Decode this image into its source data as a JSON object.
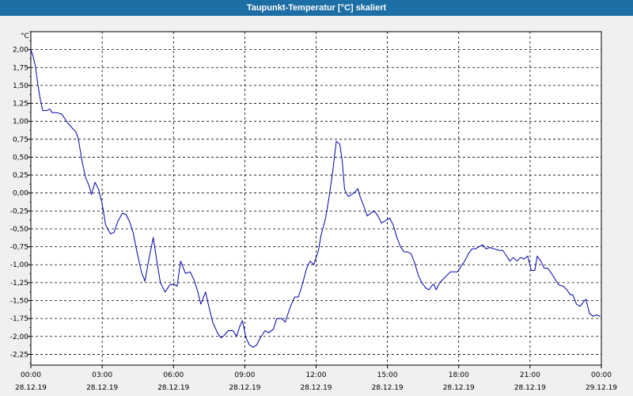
{
  "window": {
    "title": "Taupunkt-Temperatur [°C] skaliert"
  },
  "chart_data": {
    "type": "line",
    "title": "Taupunkt-Temperatur [°C] skaliert",
    "ylabel": "°C",
    "xlabel": "",
    "ylim": [
      -2.4,
      2.25
    ],
    "xlim": [
      0,
      24
    ],
    "grid": true,
    "y_ticks": [
      "2,00",
      "1,75",
      "1,50",
      "1,25",
      "1,00",
      "0,75",
      "0,50",
      "0,25",
      "0,00",
      "-0,25",
      "-0,50",
      "-0,75",
      "-1,00",
      "-1,25",
      "-1,50",
      "-1,75",
      "-2,00",
      "-2,25"
    ],
    "y_tick_values": [
      2.0,
      1.75,
      1.5,
      1.25,
      1.0,
      0.75,
      0.5,
      0.25,
      0.0,
      -0.25,
      -0.5,
      -0.75,
      -1.0,
      -1.25,
      -1.5,
      -1.75,
      -2.0,
      -2.25
    ],
    "x_ticks": [
      {
        "time": "00:00",
        "date": "28.12.19",
        "hour": 0
      },
      {
        "time": "03:00",
        "date": "28.12.19",
        "hour": 3
      },
      {
        "time": "06:00",
        "date": "28.12.19",
        "hour": 6
      },
      {
        "time": "09:00",
        "date": "28.12.19",
        "hour": 9
      },
      {
        "time": "12:00",
        "date": "28.12.19",
        "hour": 12
      },
      {
        "time": "15:00",
        "date": "28.12.19",
        "hour": 15
      },
      {
        "time": "18:00",
        "date": "28.12.19",
        "hour": 18
      },
      {
        "time": "21:00",
        "date": "28.12.19",
        "hour": 21
      },
      {
        "time": "00:00",
        "date": "29.12.19",
        "hour": 24
      }
    ],
    "series": [
      {
        "color": "#0000aa",
        "points": [
          [
            0.0,
            2.0
          ],
          [
            0.1,
            1.9
          ],
          [
            0.2,
            1.75
          ],
          [
            0.3,
            1.5
          ],
          [
            0.4,
            1.3
          ],
          [
            0.5,
            1.15
          ],
          [
            0.65,
            1.15
          ],
          [
            0.8,
            1.17
          ],
          [
            0.9,
            1.12
          ],
          [
            1.1,
            1.12
          ],
          [
            1.3,
            1.1
          ],
          [
            1.5,
            1.0
          ],
          [
            1.7,
            0.92
          ],
          [
            1.9,
            0.85
          ],
          [
            2.0,
            0.75
          ],
          [
            2.15,
            0.45
          ],
          [
            2.3,
            0.22
          ],
          [
            2.45,
            0.1
          ],
          [
            2.55,
            -0.02
          ],
          [
            2.7,
            0.15
          ],
          [
            2.85,
            0.05
          ],
          [
            3.0,
            -0.15
          ],
          [
            3.15,
            -0.45
          ],
          [
            3.35,
            -0.57
          ],
          [
            3.5,
            -0.55
          ],
          [
            3.65,
            -0.4
          ],
          [
            3.85,
            -0.28
          ],
          [
            4.0,
            -0.3
          ],
          [
            4.15,
            -0.4
          ],
          [
            4.3,
            -0.55
          ],
          [
            4.45,
            -0.8
          ],
          [
            4.65,
            -1.1
          ],
          [
            4.8,
            -1.23
          ],
          [
            4.95,
            -0.95
          ],
          [
            5.15,
            -0.62
          ],
          [
            5.3,
            -0.95
          ],
          [
            5.45,
            -1.25
          ],
          [
            5.65,
            -1.38
          ],
          [
            5.85,
            -1.28
          ],
          [
            6.0,
            -1.27
          ],
          [
            6.15,
            -1.3
          ],
          [
            6.3,
            -0.95
          ],
          [
            6.5,
            -1.12
          ],
          [
            6.7,
            -1.1
          ],
          [
            6.85,
            -1.2
          ],
          [
            7.0,
            -1.35
          ],
          [
            7.15,
            -1.55
          ],
          [
            7.35,
            -1.38
          ],
          [
            7.5,
            -1.6
          ],
          [
            7.65,
            -1.8
          ],
          [
            7.85,
            -1.95
          ],
          [
            8.0,
            -2.02
          ],
          [
            8.15,
            -1.98
          ],
          [
            8.3,
            -1.92
          ],
          [
            8.5,
            -1.92
          ],
          [
            8.65,
            -2.0
          ],
          [
            8.8,
            -1.85
          ],
          [
            8.9,
            -1.78
          ],
          [
            9.05,
            -2.02
          ],
          [
            9.2,
            -2.12
          ],
          [
            9.35,
            -2.15
          ],
          [
            9.5,
            -2.12
          ],
          [
            9.65,
            -2.02
          ],
          [
            9.85,
            -1.92
          ],
          [
            10.0,
            -1.95
          ],
          [
            10.2,
            -1.9
          ],
          [
            10.35,
            -1.75
          ],
          [
            10.55,
            -1.75
          ],
          [
            10.7,
            -1.8
          ],
          [
            10.9,
            -1.6
          ],
          [
            11.1,
            -1.45
          ],
          [
            11.25,
            -1.45
          ],
          [
            11.4,
            -1.3
          ],
          [
            11.6,
            -1.05
          ],
          [
            11.75,
            -0.95
          ],
          [
            11.9,
            -1.0
          ],
          [
            12.1,
            -0.8
          ],
          [
            12.2,
            -0.6
          ],
          [
            12.4,
            -0.35
          ],
          [
            12.55,
            -0.05
          ],
          [
            12.7,
            0.3
          ],
          [
            12.85,
            0.72
          ],
          [
            13.0,
            0.68
          ],
          [
            13.1,
            0.45
          ],
          [
            13.2,
            0.05
          ],
          [
            13.35,
            -0.05
          ],
          [
            13.5,
            -0.02
          ],
          [
            13.65,
            0.02
          ],
          [
            13.75,
            0.06
          ],
          [
            13.85,
            -0.05
          ],
          [
            14.0,
            -0.18
          ],
          [
            14.15,
            -0.32
          ],
          [
            14.3,
            -0.28
          ],
          [
            14.45,
            -0.25
          ],
          [
            14.6,
            -0.32
          ],
          [
            14.75,
            -0.42
          ],
          [
            14.95,
            -0.38
          ],
          [
            15.1,
            -0.35
          ],
          [
            15.25,
            -0.45
          ],
          [
            15.4,
            -0.62
          ],
          [
            15.55,
            -0.75
          ],
          [
            15.7,
            -0.82
          ],
          [
            15.85,
            -0.82
          ],
          [
            16.0,
            -0.85
          ],
          [
            16.15,
            -0.98
          ],
          [
            16.3,
            -1.15
          ],
          [
            16.45,
            -1.25
          ],
          [
            16.6,
            -1.32
          ],
          [
            16.75,
            -1.35
          ],
          [
            16.85,
            -1.3
          ],
          [
            16.95,
            -1.27
          ],
          [
            17.05,
            -1.35
          ],
          [
            17.2,
            -1.25
          ],
          [
            17.35,
            -1.2
          ],
          [
            17.5,
            -1.15
          ],
          [
            17.65,
            -1.1
          ],
          [
            17.8,
            -1.1
          ],
          [
            17.95,
            -1.1
          ],
          [
            18.1,
            -1.02
          ],
          [
            18.25,
            -0.95
          ],
          [
            18.4,
            -0.85
          ],
          [
            18.55,
            -0.78
          ],
          [
            18.7,
            -0.78
          ],
          [
            18.85,
            -0.75
          ],
          [
            19.0,
            -0.72
          ],
          [
            19.15,
            -0.78
          ],
          [
            19.3,
            -0.76
          ],
          [
            19.5,
            -0.78
          ],
          [
            19.7,
            -0.8
          ],
          [
            19.85,
            -0.8
          ],
          [
            20.0,
            -0.87
          ],
          [
            20.15,
            -0.95
          ],
          [
            20.3,
            -0.9
          ],
          [
            20.45,
            -0.95
          ],
          [
            20.6,
            -0.9
          ],
          [
            20.75,
            -0.92
          ],
          [
            20.9,
            -0.88
          ],
          [
            21.05,
            -1.08
          ],
          [
            21.2,
            -1.08
          ],
          [
            21.3,
            -0.88
          ],
          [
            21.45,
            -0.95
          ],
          [
            21.6,
            -1.05
          ],
          [
            21.75,
            -1.05
          ],
          [
            21.9,
            -1.12
          ],
          [
            22.05,
            -1.2
          ],
          [
            22.2,
            -1.28
          ],
          [
            22.4,
            -1.3
          ],
          [
            22.55,
            -1.35
          ],
          [
            22.7,
            -1.42
          ],
          [
            22.8,
            -1.42
          ],
          [
            22.95,
            -1.55
          ],
          [
            23.1,
            -1.58
          ],
          [
            23.25,
            -1.52
          ],
          [
            23.35,
            -1.48
          ],
          [
            23.5,
            -1.68
          ],
          [
            23.65,
            -1.72
          ],
          [
            23.8,
            -1.7
          ],
          [
            23.95,
            -1.72
          ]
        ]
      }
    ]
  }
}
